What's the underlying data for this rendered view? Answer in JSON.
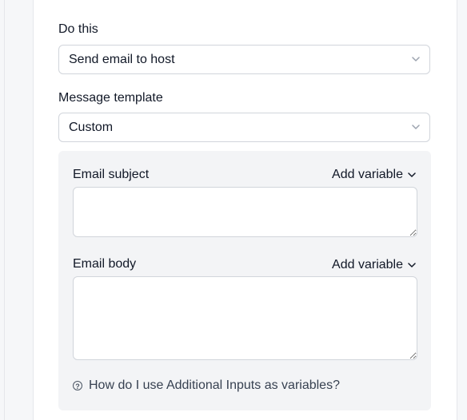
{
  "action": {
    "label": "Do this",
    "value": "Send email to host"
  },
  "template": {
    "label": "Message template",
    "value": "Custom"
  },
  "email_subject": {
    "label": "Email subject",
    "add_variable": "Add variable",
    "value": ""
  },
  "email_body": {
    "label": "Email body",
    "add_variable": "Add variable",
    "value": ""
  },
  "help": {
    "text": "How do I use Additional Inputs as variables?",
    "icon": "question-circle-icon"
  }
}
